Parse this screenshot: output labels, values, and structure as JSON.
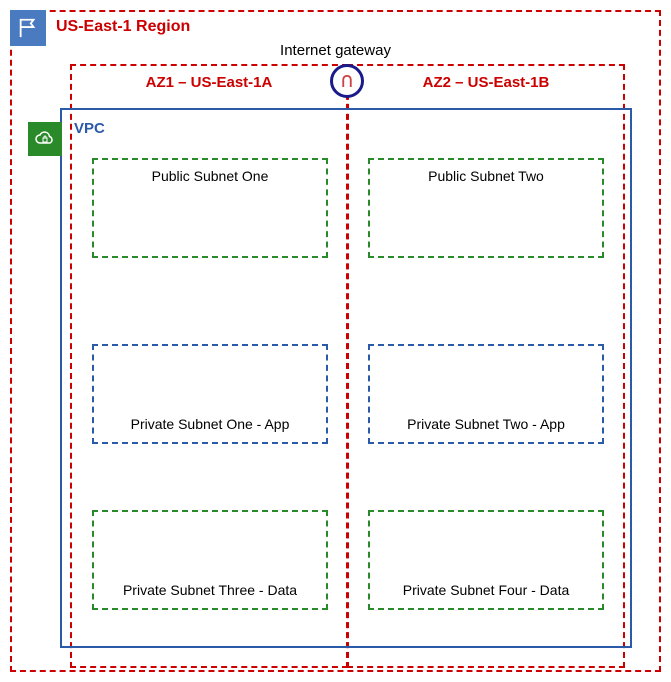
{
  "region": {
    "title": "US-East-1 Region"
  },
  "igw": {
    "label": "Internet gateway"
  },
  "az1": {
    "title": "AZ1 – US-East-1A"
  },
  "az2": {
    "title": "AZ2 – US-East-1B"
  },
  "vpc": {
    "title": "VPC"
  },
  "subnets": {
    "pub1": "Public Subnet One",
    "pub2": "Public Subnet Two",
    "priv1": "Private Subnet One - App",
    "priv2": "Private Subnet Two - App",
    "priv3": "Private Subnet Three - Data",
    "priv4": "Private Subnet Four - Data"
  },
  "chart_data": {
    "type": "diagram",
    "title": "AWS VPC multi-AZ network layout",
    "region": "US-East-1",
    "availability_zones": [
      {
        "name": "AZ1",
        "zone_id": "US-East-1A"
      },
      {
        "name": "AZ2",
        "zone_id": "US-East-1B"
      }
    ],
    "internet_gateway": true,
    "vpc": {
      "subnets": [
        {
          "name": "Public Subnet One",
          "az": "US-East-1A",
          "tier": "public"
        },
        {
          "name": "Public Subnet Two",
          "az": "US-East-1B",
          "tier": "public"
        },
        {
          "name": "Private Subnet One - App",
          "az": "US-East-1A",
          "tier": "private-app"
        },
        {
          "name": "Private Subnet Two - App",
          "az": "US-East-1B",
          "tier": "private-app"
        },
        {
          "name": "Private Subnet Three - Data",
          "az": "US-East-1A",
          "tier": "private-data"
        },
        {
          "name": "Private Subnet Four - Data",
          "az": "US-East-1B",
          "tier": "private-data"
        }
      ]
    }
  }
}
